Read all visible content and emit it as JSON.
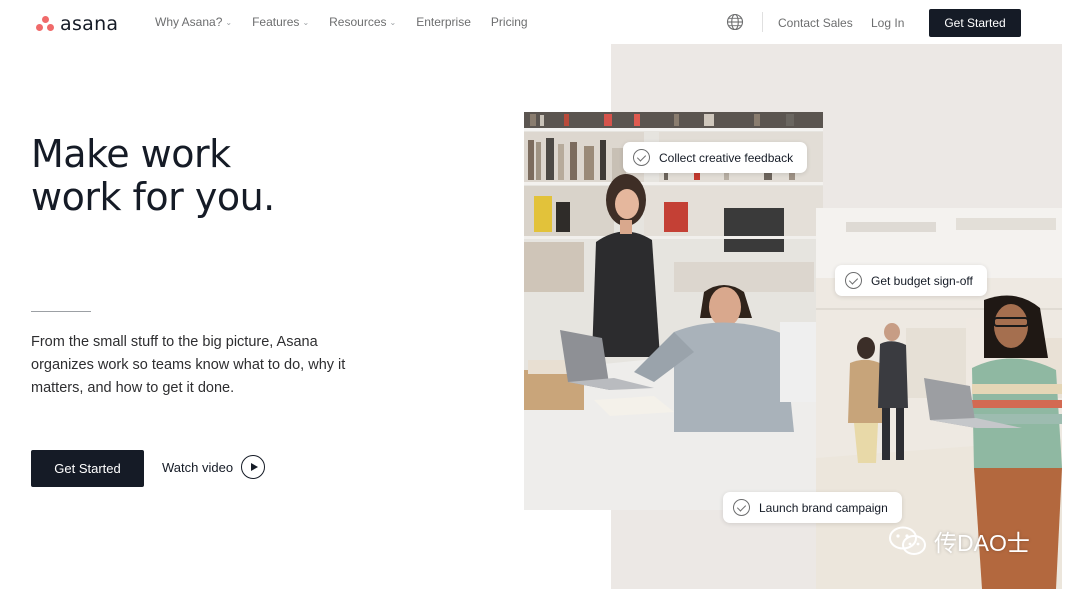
{
  "brand": {
    "name": "asana",
    "dot_color": "#f06a6a"
  },
  "nav": {
    "items": [
      {
        "label": "Why Asana?",
        "has_dropdown": true
      },
      {
        "label": "Features",
        "has_dropdown": true
      },
      {
        "label": "Resources",
        "has_dropdown": true
      },
      {
        "label": "Enterprise",
        "has_dropdown": false
      },
      {
        "label": "Pricing",
        "has_dropdown": false
      }
    ],
    "globe_icon": "globe-icon",
    "contact": "Contact Sales",
    "login": "Log In",
    "cta": "Get Started"
  },
  "hero": {
    "headline_line1": "Make work",
    "headline_line2": "work for you.",
    "subtext": "From the small stuff to the big picture, Asana organizes work so teams know what to do, why it matters, and how to get it done.",
    "cta": "Get Started",
    "watch_label": "Watch video",
    "play_icon": "play-circle-icon"
  },
  "tasks": [
    {
      "label": "Collect creative feedback"
    },
    {
      "label": "Get budget sign-off"
    },
    {
      "label": "Launch brand campaign"
    }
  ],
  "watermark": {
    "text": "传DAO士",
    "icon": "wechat-icon"
  },
  "colors": {
    "dark": "#151b26",
    "panel": "#ece8e5",
    "text_muted": "#6d6e6f"
  }
}
